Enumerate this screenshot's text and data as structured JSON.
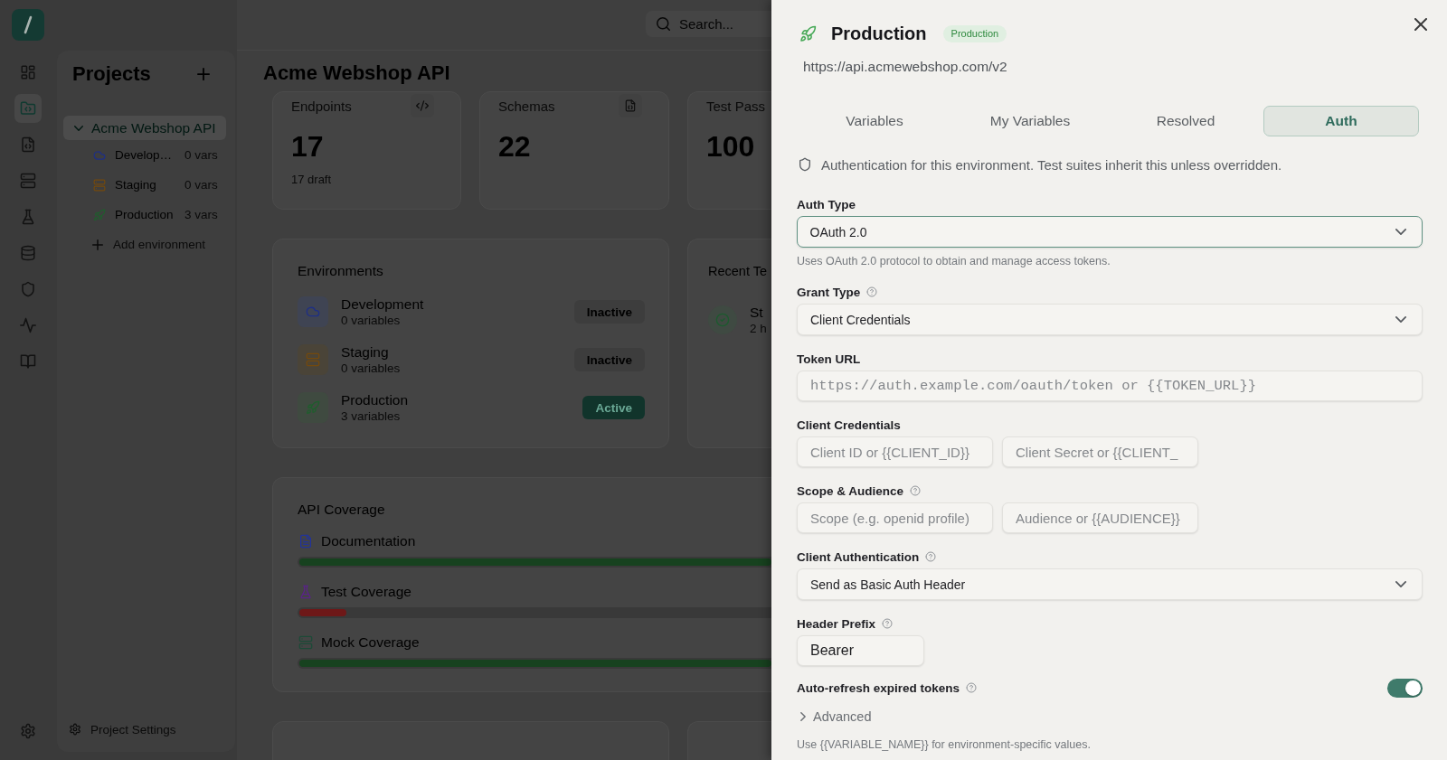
{
  "nav_rail": {
    "items": [
      {
        "selected": false
      },
      {
        "selected": true
      },
      {
        "selected": false
      },
      {
        "selected": false
      },
      {
        "selected": false
      },
      {
        "selected": false
      },
      {
        "selected": false
      },
      {
        "selected": false
      },
      {
        "selected": false
      }
    ]
  },
  "projects_panel": {
    "title": "Projects",
    "projects": [
      {
        "name": "Acme Webshop API",
        "expanded": true,
        "selected": true,
        "environments": [
          {
            "name": "Develop…",
            "count": "0 vars",
            "kind": "development"
          },
          {
            "name": "Staging",
            "count": "0 vars",
            "kind": "staging"
          },
          {
            "name": "Production",
            "count": "3 vars",
            "kind": "production"
          }
        ]
      }
    ],
    "add_environment": "Add environment",
    "settings": "Project Settings"
  },
  "top_bar": {
    "search": {
      "placeholder": "Search..."
    }
  },
  "page": {
    "title": "Acme Webshop API",
    "stats": [
      {
        "label": "Endpoints",
        "value": "17",
        "note": "17 draft"
      },
      {
        "label": "Schemas",
        "value": "22"
      },
      {
        "label": "Test Pass",
        "value": "100"
      }
    ],
    "environments": {
      "title": "Environments",
      "rows": [
        {
          "name": "Development",
          "detail": "0 variables",
          "kind": "development",
          "status": "Inactive",
          "active": false
        },
        {
          "name": "Staging",
          "detail": "0 variables",
          "kind": "staging",
          "status": "Inactive",
          "active": false
        },
        {
          "name": "Production",
          "detail": "3 variables",
          "kind": "production",
          "status": "Active",
          "active": true
        }
      ]
    },
    "recent_tests": {
      "title": "Recent Te",
      "rows": [
        {
          "name": "St",
          "detail": "2 h"
        }
      ]
    },
    "coverage": {
      "title": "API Coverage",
      "rows": [
        {
          "name": "Documentation",
          "level": 1
        },
        {
          "name": "Test Coverage",
          "level": 0.1
        },
        {
          "name": "Mock Coverage",
          "level": 1
        }
      ]
    }
  },
  "drawer": {
    "title": "Production",
    "badge": "Production",
    "kind": "production",
    "url": "https://api.acmewebshop.com/v2",
    "tabs": [
      {
        "label": "Variables",
        "selected": false
      },
      {
        "label": "My Variables",
        "selected": false
      },
      {
        "label": "Resolved",
        "selected": false
      },
      {
        "label": "Auth",
        "selected": true
      }
    ],
    "info": "Authentication for this environment. Test suites inherit this unless overridden.",
    "fields": [
      {
        "kind": "select",
        "label": "Auth Type",
        "help": false,
        "value": "OAuth 2.0",
        "focused": true,
        "hint": "Uses OAuth 2.0 protocol to obtain and manage access tokens."
      },
      {
        "kind": "select",
        "label": "Grant Type",
        "help": true,
        "value": "Client Credentials",
        "focused": false
      },
      {
        "kind": "url",
        "label": "Token URL",
        "help": false,
        "inputs": [
          {
            "placeholder": "https://auth.example.com/oauth/token or {{TOKEN_URL}}"
          }
        ]
      },
      {
        "kind": "pair",
        "label": "Client Credentials",
        "help": false,
        "inputs": [
          {
            "placeholder": "Client ID or {{CLIENT_ID}}"
          },
          {
            "placeholder": "Client Secret or {{CLIENT_"
          }
        ]
      },
      {
        "kind": "pair",
        "label": "Scope & Audience",
        "help": true,
        "inputs": [
          {
            "placeholder": "Scope (e.g. openid profile)"
          },
          {
            "placeholder": "Audience or {{AUDIENCE}}"
          }
        ]
      },
      {
        "kind": "select",
        "label": "Client Authentication",
        "help": true,
        "value": "Send as Basic Auth Header",
        "focused": false
      },
      {
        "kind": "text",
        "label": "Header Prefix",
        "help": true,
        "value": "Bearer"
      },
      {
        "kind": "toggle",
        "label": "Auto-refresh expired tokens",
        "help": true,
        "on": true
      },
      {
        "kind": "disclosure",
        "label": "Advanced",
        "expanded": false
      }
    ],
    "note": "Use {{VARIABLE_NAME}} for environment-specific values."
  }
}
